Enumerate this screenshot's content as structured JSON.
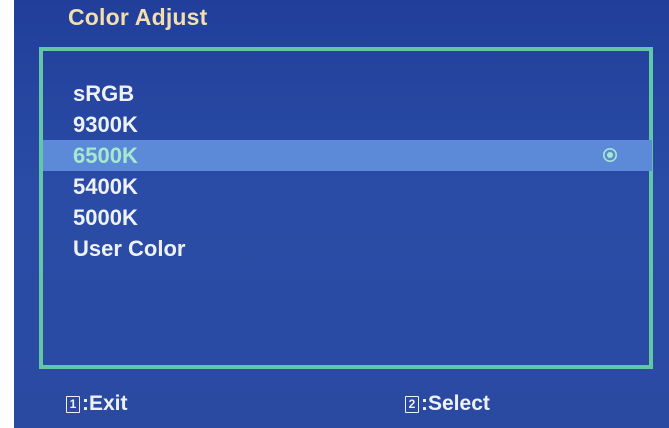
{
  "osd": {
    "title": "Color Adjust"
  },
  "menu": {
    "items": [
      {
        "label": "sRGB",
        "selected": false
      },
      {
        "label": "9300K",
        "selected": false
      },
      {
        "label": "6500K",
        "selected": true
      },
      {
        "label": "5400K",
        "selected": false
      },
      {
        "label": "5000K",
        "selected": false
      },
      {
        "label": "User Color",
        "selected": false
      }
    ],
    "selected_icon": "radio-selected-icon"
  },
  "footer": {
    "exit": {
      "key": "1",
      "label": ":Exit"
    },
    "select": {
      "key": "2",
      "label": ":Select"
    }
  },
  "colors": {
    "background": "#2a4aa2",
    "title": "#f4deae",
    "frame": "#62c7a7",
    "highlight": "#5c8ad8",
    "selected_text": "#a6e8d0",
    "text": "#eef1f7"
  }
}
